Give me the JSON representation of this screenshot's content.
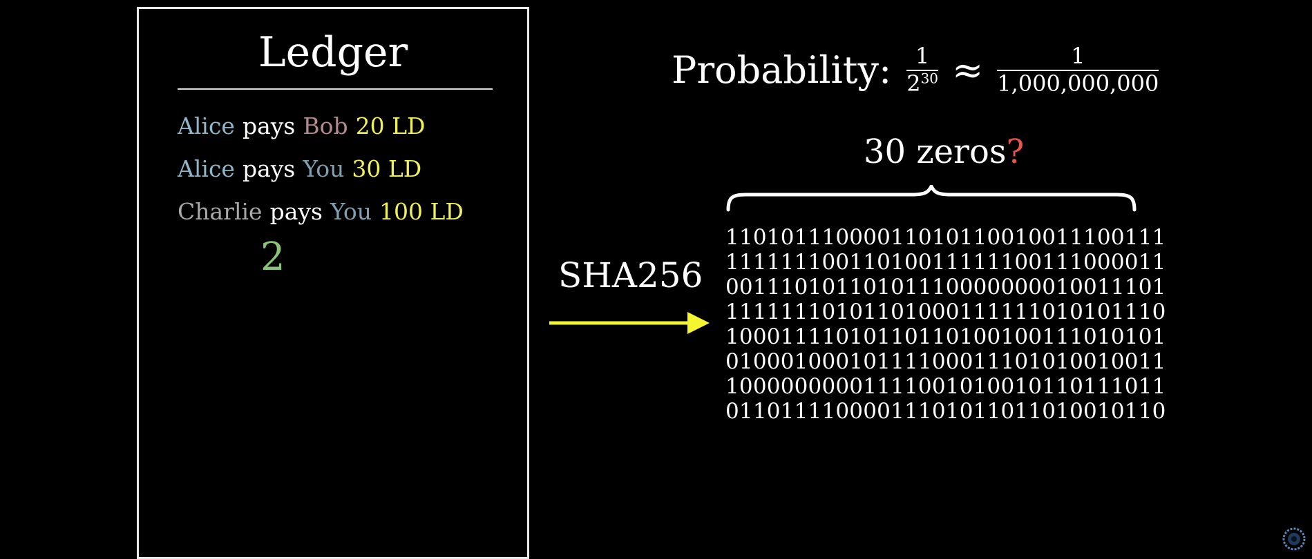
{
  "ledger": {
    "title": "Ledger",
    "transactions": [
      {
        "from": "Alice",
        "verb": "pays",
        "to": "Bob",
        "amount": "20 LD",
        "from_color": "#8fb5c9",
        "to_color": "#b58a8f"
      },
      {
        "from": "Alice",
        "verb": "pays",
        "to": "You",
        "amount": "30 LD",
        "from_color": "#8fb5c9",
        "to_color": "#7fa0b0"
      },
      {
        "from": "Charlie",
        "verb": "pays",
        "to": "You",
        "amount": "100 LD",
        "from_color": "#a8a8a8",
        "to_color": "#7fa0b0"
      }
    ],
    "nonce": "2"
  },
  "probability": {
    "label": "Probability:",
    "numerator": "1",
    "denominator_base": "2",
    "denominator_exp": "30",
    "approx_symbol": "≈",
    "approx_numerator": "1",
    "approx_denominator": "1,000,000,000"
  },
  "zeros": {
    "label": "30 zeros",
    "question": "?"
  },
  "hash": {
    "label": "SHA256",
    "bits": [
      "11010111000011010110010011100111",
      "11111110011010011111100111000011",
      "00111010110101110000000010011101",
      "11111110101101000111111010101110",
      "10001111010110110100100111010101",
      "01000100010111100011101010010011",
      "10000000001111001010010110111011",
      "01101111000011101011011010010110"
    ]
  },
  "colors": {
    "background": "#000000",
    "text": "#ffffff",
    "amount": "#f0f05a",
    "nonce": "#8bc37a",
    "question": "#e8564a",
    "arrow": "#f5f530"
  }
}
